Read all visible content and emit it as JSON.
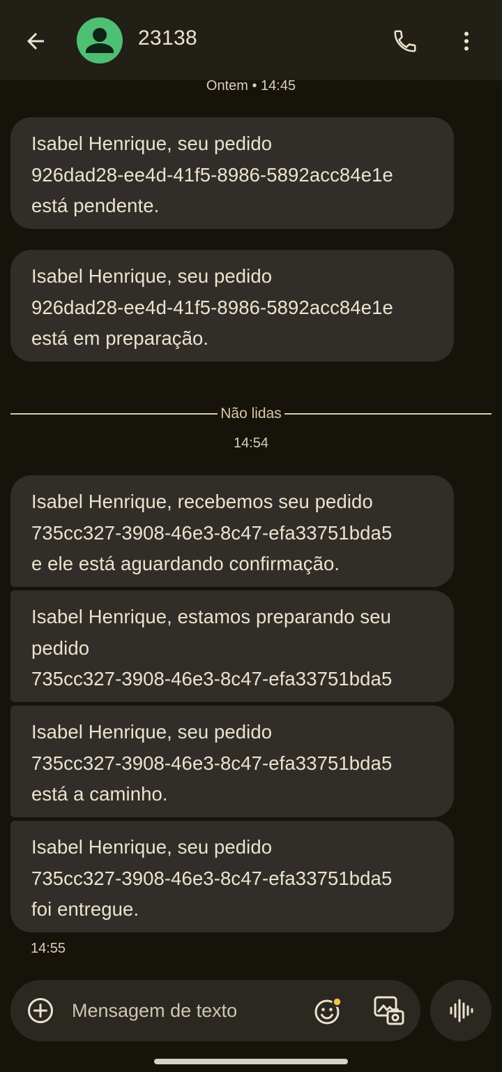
{
  "header": {
    "contact_name": "23138",
    "icons": [
      "arrow-left-icon",
      "person-icon",
      "phone-icon",
      "more-vert-icon"
    ]
  },
  "conversation": {
    "timestamp_top": "Ontem • 14:45",
    "messages_read": [
      {
        "lines": [
          "Isabel Henrique, seu pedido",
          "926dad28-ee4d-41f5-8986-5892acc84e1e",
          "está pendente."
        ]
      },
      {
        "lines": [
          "Isabel Henrique, seu pedido",
          "926dad28-ee4d-41f5-8986-5892acc84e1e",
          "está em preparação."
        ]
      }
    ],
    "unread_label": "Não lidas",
    "timestamp_unread": "14:54",
    "messages_unread": [
      {
        "lines": [
          "Isabel Henrique, recebemos seu pedido",
          "735cc327-3908-46e3-8c47-efa33751bda5",
          "e ele está aguardando confirmação."
        ]
      },
      {
        "lines": [
          "Isabel Henrique, estamos preparando seu",
          "pedido",
          "735cc327-3908-46e3-8c47-efa33751bda5"
        ]
      },
      {
        "lines": [
          "Isabel Henrique, seu pedido",
          "735cc327-3908-46e3-8c47-efa33751bda5",
          "está a caminho."
        ]
      },
      {
        "lines": [
          "Isabel Henrique, seu pedido",
          "735cc327-3908-46e3-8c47-efa33751bda5",
          "foi entregue."
        ]
      }
    ],
    "timestamp_last": "14:55"
  },
  "composer": {
    "placeholder": "Mensagem de texto",
    "icons": [
      "plus-circle-icon",
      "emoji-icon",
      "gallery-icon",
      "voice-waveform-icon"
    ]
  },
  "colors": {
    "background": "#16130b",
    "app_bar": "#221f16",
    "bubble": "#312d28",
    "avatar": "#4fbf73",
    "unread_divider": "#d7c9a4",
    "emoji_badge": "#f2c14e"
  }
}
